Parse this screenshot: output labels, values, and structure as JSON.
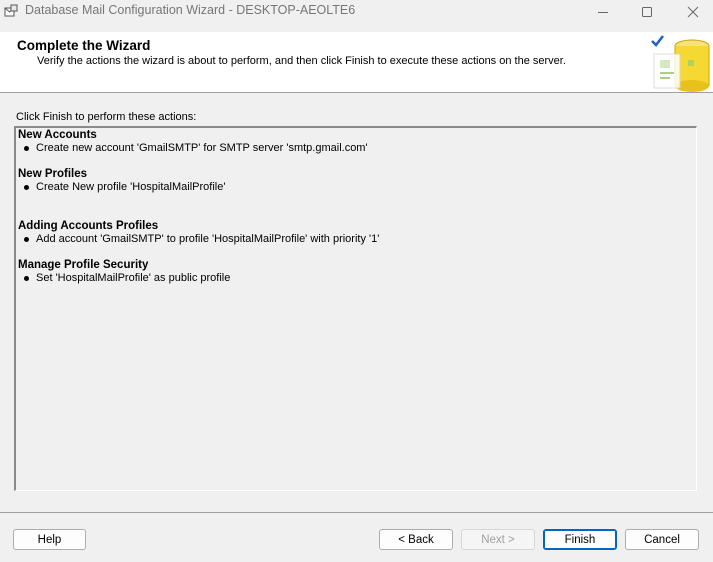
{
  "window": {
    "title": "Database Mail Configuration Wizard - DESKTOP-AEOLTE6",
    "controls": {
      "minimize_icon": "minimize-icon",
      "maximize_icon": "maximize-icon",
      "close_icon": "close-icon"
    }
  },
  "header": {
    "title": "Complete the Wizard",
    "subtitle": "Verify the actions the wizard is about to perform, and then click Finish to execute these actions on the server.",
    "graphic_icon": "database-checkmark-icon"
  },
  "main": {
    "instruction": "Click Finish to perform these actions:",
    "sections": [
      {
        "title": "New Accounts",
        "items": [
          "Create new account 'GmailSMTP' for SMTP server 'smtp.gmail.com'"
        ]
      },
      {
        "title": "New Profiles",
        "items": [
          "Create New profile 'HospitalMailProfile'"
        ]
      },
      {
        "title": "Adding Accounts Profiles",
        "items": [
          "Add account 'GmailSMTP' to profile 'HospitalMailProfile' with priority '1'"
        ]
      },
      {
        "title": "Manage Profile Security",
        "items": [
          "Set 'HospitalMailProfile' as public profile"
        ]
      }
    ]
  },
  "footer": {
    "help_label": "Help",
    "back_label": "< Back",
    "next_label": "Next >",
    "finish_label": "Finish",
    "cancel_label": "Cancel"
  },
  "colors": {
    "accent": "#0067c0",
    "check": "#1f5fbf",
    "graphic_yellow": "#f5d832"
  }
}
